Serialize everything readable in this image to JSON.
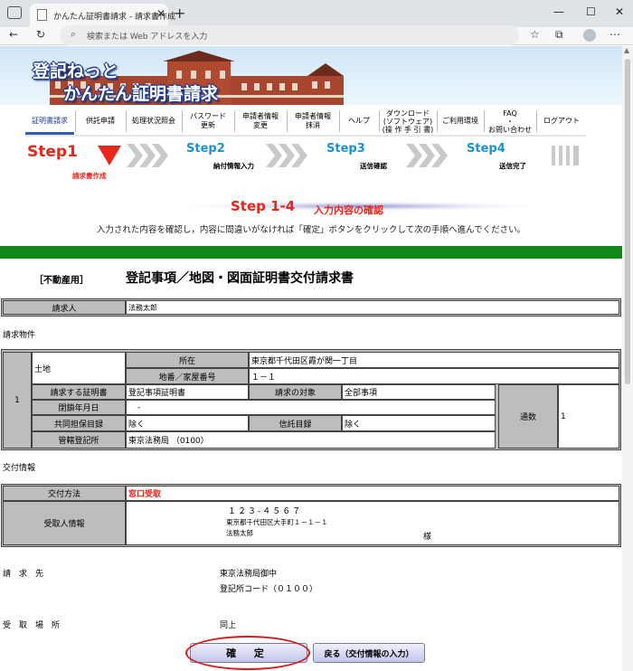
{
  "browser": {
    "tab_title": "かんたん証明書請求 - 請求書作成",
    "address_placeholder": "検索または Web アドレスを入力"
  },
  "banner": {
    "line1": "登記ねっと",
    "line2": "かんたん証明書請求"
  },
  "menu": [
    {
      "id": "certificate-request",
      "line1": "証明書請求",
      "line2": "",
      "active": true
    },
    {
      "id": "supply-request",
      "line1": "供託申請",
      "line2": ""
    },
    {
      "id": "status-inquiry",
      "line1": "処理状況照会",
      "line2": ""
    },
    {
      "id": "password-update",
      "line1": "パスワード",
      "line2": "更新"
    },
    {
      "id": "applicant-info-change",
      "line1": "申請者情報",
      "line2": "変更"
    },
    {
      "id": "applicant-info-delete",
      "line1": "申請者情報",
      "line2": "抹消"
    },
    {
      "id": "help",
      "line1": "ヘルプ",
      "line2": ""
    },
    {
      "id": "download",
      "line1": "ダウンロード",
      "line2": "(ソフトウェア)",
      "line3": "(操 作 手 引 書)"
    },
    {
      "id": "usage-environment",
      "line1": "ご利用環境",
      "line2": ""
    },
    {
      "id": "faq",
      "line1": "FAQ",
      "line2": "・",
      "line3": "お問い合わせ"
    },
    {
      "id": "logout",
      "line1": "ログアウト",
      "line2": ""
    }
  ],
  "steps": {
    "step1": {
      "label": "Step1",
      "sub": "請求書作成"
    },
    "step2": {
      "label": "Step2",
      "sub": "納付情報入力"
    },
    "step3": {
      "label": "Step3",
      "sub": "送信確認"
    },
    "step4": {
      "label": "Step4",
      "sub": "送信完了"
    }
  },
  "substep": {
    "big": "Step 1-4",
    "small": "入力内容の確認"
  },
  "instructions": "入力された内容を確認し，内容に間違いがなければ「確定」ボタンをクリックして次の手順へ進んでください。",
  "document": {
    "prefix": "［不動産用］",
    "title": "登記事項／地図・図面証明書交付請求書"
  },
  "requester": {
    "label": "請求人",
    "value": "法務太郎"
  },
  "property": {
    "section_label": "請求物件",
    "row_number": "1",
    "type": "土地",
    "location_label": "所在",
    "location_value": "東京都千代田区霞が関一丁目",
    "lot_label": "地番／家屋番号",
    "lot_value": "１－１",
    "cert_label": "請求する証明書",
    "cert_value": "登記事項証明書",
    "target_label": "請求の対象",
    "target_value": "全部事項",
    "closed_date_label": "閉鎖年月日",
    "closed_date_value": "-",
    "collateral_label": "共同担保目録",
    "collateral_value": "除く",
    "trust_label": "信託目録",
    "trust_value": "除く",
    "copies_label": "通数",
    "copies_value": "1",
    "office_label": "管轄登記所",
    "office_value": "東京法務局 （0100）"
  },
  "delivery": {
    "section_label": "交付情報",
    "method_label": "交付方法",
    "method_value": "窓口受取",
    "recipient_label": "受取人情報",
    "postal": "１２３-４５６７",
    "address": "東京都千代田区大手町１－１－１",
    "name": "法務太郎",
    "honorific": "様"
  },
  "request_to": {
    "label": "請　求　先",
    "office": "東京法務局御中",
    "code": "登記所コード（０１００）"
  },
  "pickup": {
    "label": "受　取　場　所",
    "value": "同上"
  },
  "buttons": {
    "confirm": "確 定",
    "back": "戻る（交付情報の入力）"
  },
  "colors": {
    "accent_red": "#e8271b",
    "step_blue": "#1a92d0",
    "green_bar": "#0f8a18",
    "header_grey": "#bdbdbd"
  }
}
